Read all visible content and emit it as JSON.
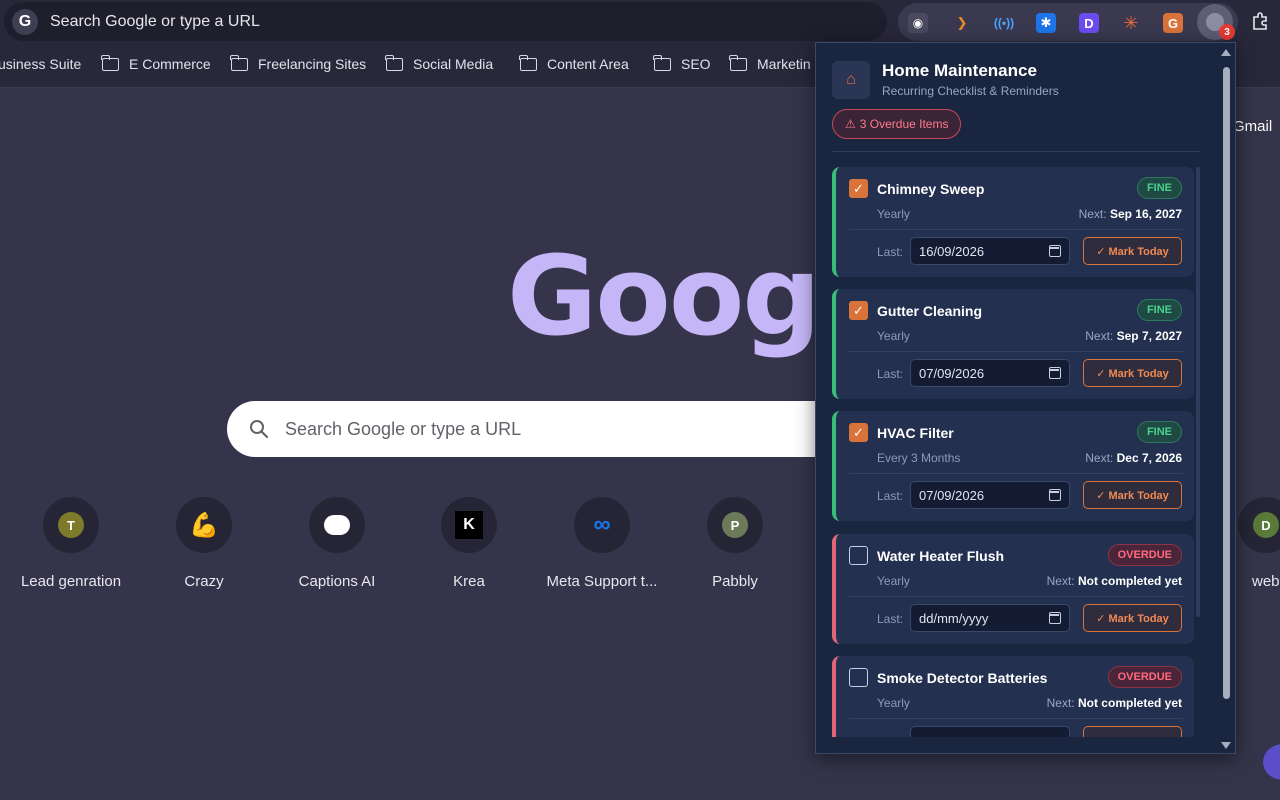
{
  "omnibox": {
    "placeholder": "Search Google or type a URL"
  },
  "toolbar": {
    "profile_badge": "3"
  },
  "bookmarks": [
    "usiness Suite",
    "E Commerce",
    "Freelancing Sites",
    "Social Media",
    "Content Area",
    "SEO",
    "Marketin"
  ],
  "ntp": {
    "logo": "Google",
    "search_placeholder": "Search Google or type a URL",
    "gmail_link": "Gmail",
    "shortcuts": [
      {
        "label": "Lead genration",
        "letter": "T"
      },
      {
        "label": "Crazy",
        "letter": ""
      },
      {
        "label": "Captions AI",
        "letter": ""
      },
      {
        "label": "Krea",
        "letter": ""
      },
      {
        "label": "Meta Support t...",
        "letter": ""
      },
      {
        "label": "Pabbly",
        "letter": "P"
      },
      {
        "label": "web",
        "letter": "D"
      }
    ]
  },
  "popup": {
    "title": "Home Maintenance",
    "subtitle": "Recurring Checklist & Reminders",
    "overdue_text": "3 Overdue Items",
    "last_label": "Last:",
    "next_label": "Next:",
    "mark_label": "✓ Mark Today",
    "tasks": [
      {
        "name": "Chimney Sweep",
        "status": "FINE",
        "frequency": "Yearly",
        "next": "Sep 16, 2027",
        "last": "16/09/2026",
        "checked": true
      },
      {
        "name": "Gutter Cleaning",
        "status": "FINE",
        "frequency": "Yearly",
        "next": "Sep 7, 2027",
        "last": "07/09/2026",
        "checked": true
      },
      {
        "name": "HVAC Filter",
        "status": "FINE",
        "frequency": "Every 3 Months",
        "next": "Dec 7, 2026",
        "last": "07/09/2026",
        "checked": true
      },
      {
        "name": "Water Heater Flush",
        "status": "OVERDUE",
        "frequency": "Yearly",
        "next": "Not completed yet",
        "last": "dd/mm/yyyy",
        "checked": false
      },
      {
        "name": "Smoke Detector Batteries",
        "status": "OVERDUE",
        "frequency": "Yearly",
        "next": "Not completed yet",
        "last": "",
        "checked": false
      }
    ]
  }
}
